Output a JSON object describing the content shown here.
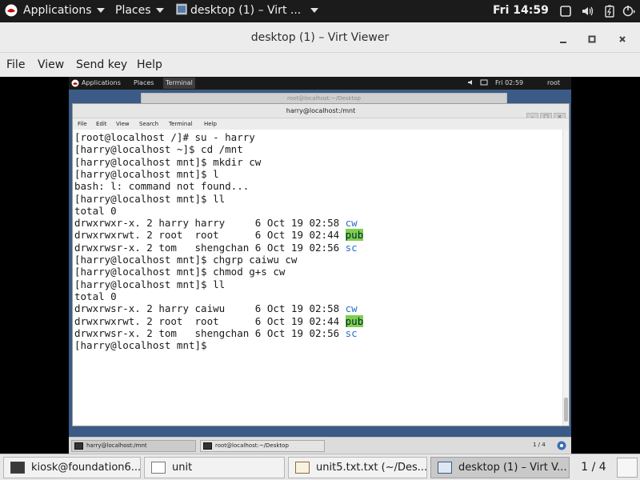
{
  "host_panel": {
    "applications": "Applications",
    "places": "Places",
    "active_window": "desktop (1) – Virt ...",
    "clock": "Fri 14:59"
  },
  "viewer": {
    "title": "desktop (1) – Virt Viewer",
    "menu": [
      "File",
      "View",
      "Send key",
      "Help"
    ]
  },
  "guest": {
    "top_panel": {
      "applications": "Applications",
      "places": "Places",
      "terminal": "Terminal",
      "clock": "Fri 02:59",
      "user": "root"
    },
    "bg_window_title": "root@localhost:~/Desktop",
    "terminal": {
      "title": "harry@localhost:/mnt",
      "menu": [
        "File",
        "Edit",
        "View",
        "Search",
        "Terminal",
        "Help"
      ],
      "lines": [
        {
          "text": "[root@localhost /]# su - harry"
        },
        {
          "text": "[harry@localhost ~]$ cd /mnt"
        },
        {
          "text": "[harry@localhost mnt]$ mkdir cw"
        },
        {
          "text": "[harry@localhost mnt]$ l"
        },
        {
          "text": "bash: l: command not found..."
        },
        {
          "text": "[harry@localhost mnt]$ ll"
        },
        {
          "text": "total 0"
        },
        {
          "text": "drwxrwxr-x. 2 harry harry     6 Oct 19 02:58 ",
          "name": "cw",
          "style": "dir"
        },
        {
          "text": "drwxrwxrwt. 2 root  root      6 Oct 19 02:44 ",
          "name": "pub",
          "style": "hl"
        },
        {
          "text": "drwxrwsr-x. 2 tom   shengchan 6 Oct 19 02:56 ",
          "name": "sc",
          "style": "dir"
        },
        {
          "text": "[harry@localhost mnt]$ chgrp caiwu cw"
        },
        {
          "text": "[harry@localhost mnt]$ chmod g+s cw"
        },
        {
          "text": "[harry@localhost mnt]$ ll"
        },
        {
          "text": "total 0"
        },
        {
          "text": "drwxrwsr-x. 2 harry caiwu     6 Oct 19 02:58 ",
          "name": "cw",
          "style": "dir"
        },
        {
          "text": "drwxrwxrwt. 2 root  root      6 Oct 19 02:44 ",
          "name": "pub",
          "style": "hl"
        },
        {
          "text": "drwxrwsr-x. 2 tom   shengchan 6 Oct 19 02:56 ",
          "name": "sc",
          "style": "dir"
        },
        {
          "text": "[harry@localhost mnt]$ "
        }
      ]
    },
    "taskbar": {
      "items": [
        "harry@localhost:/mnt",
        "root@localhost:~/Desktop"
      ],
      "pager": "1 / 4"
    }
  },
  "host_taskbar": {
    "items": [
      "kiosk@foundation6...",
      "unit",
      "unit5.txt.txt (~/Des...",
      "desktop (1) – Virt V..."
    ],
    "pager": "1 / 4"
  },
  "icons": {
    "host": [
      "redhat-logo-icon",
      "window-icon",
      "display-icon",
      "volume-icon",
      "battery-icon",
      "power-icon"
    ],
    "viewer": [
      "minimize-icon",
      "maximize-icon",
      "close-icon"
    ]
  }
}
